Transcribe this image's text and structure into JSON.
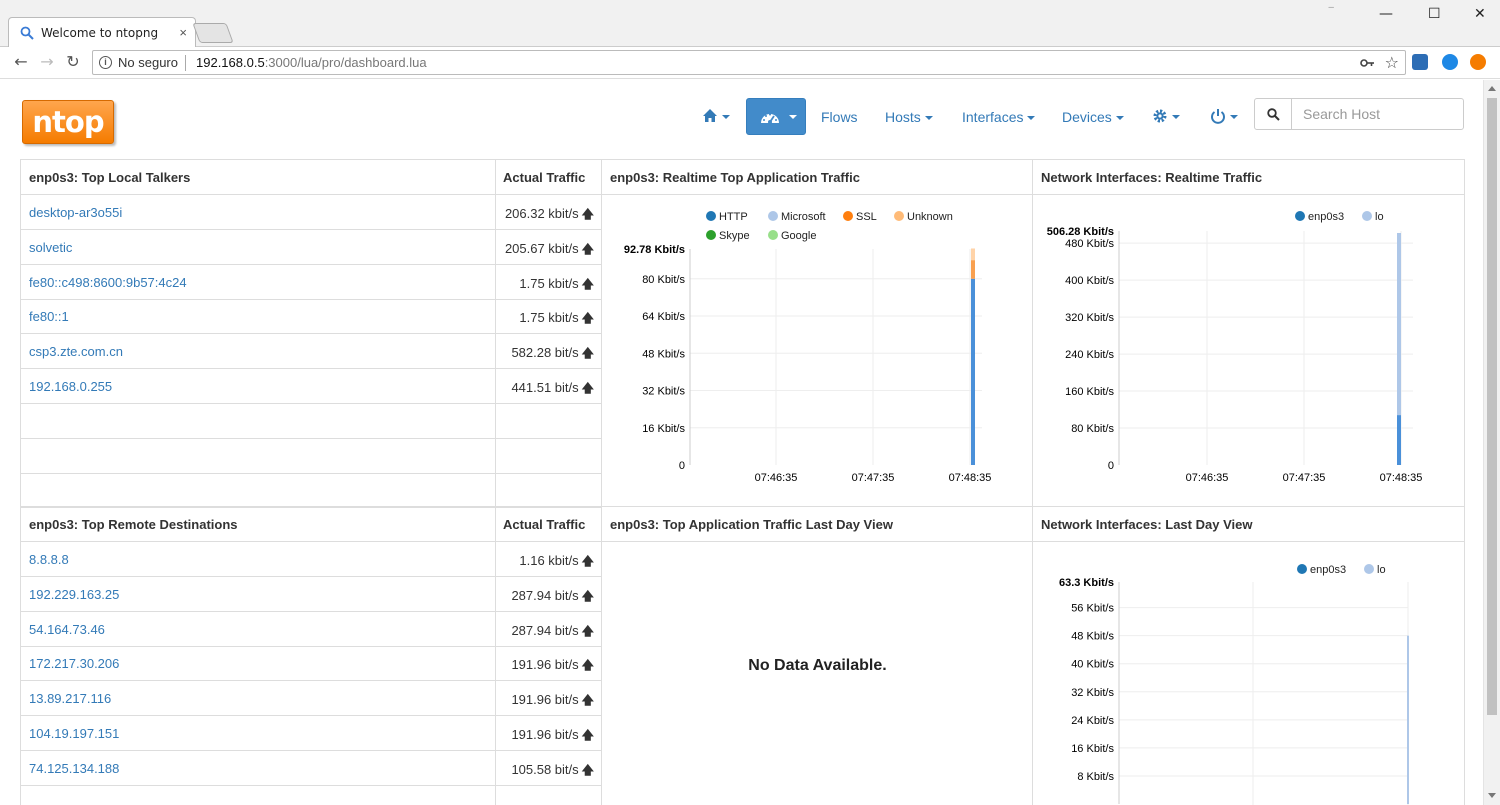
{
  "browser": {
    "tab_title": "Welcome to ntopng",
    "tab_close": "×",
    "window_minimize": "—",
    "window_maximize": "☐",
    "window_close": "✕",
    "secure_label": "No seguro",
    "url_host": "192.168.0.5",
    "url_rest": ":3000/lua/pro/dashboard.lua"
  },
  "app": {
    "logo": "ntop",
    "nav": {
      "flows": "Flows",
      "hosts": "Hosts",
      "interfaces": "Interfaces",
      "devices": "Devices"
    },
    "search_placeholder": "Search Host"
  },
  "top_local_talkers": {
    "title": "enp0s3: Top Local Talkers",
    "col_traffic": "Actual Traffic",
    "rows": [
      {
        "host": "desktop-ar3o55i",
        "traffic": "206.32 kbit/s"
      },
      {
        "host": "solvetic",
        "traffic": "205.67 kbit/s"
      },
      {
        "host": "fe80::c498:8600:9b57:4c24",
        "traffic": "1.75 kbit/s"
      },
      {
        "host": "fe80::1",
        "traffic": "1.75 kbit/s"
      },
      {
        "host": "csp3.zte.com.cn",
        "traffic": "582.28 bit/s"
      },
      {
        "host": "192.168.0.255",
        "traffic": "441.51 bit/s"
      }
    ]
  },
  "top_remote_destinations": {
    "title": "enp0s3: Top Remote Destinations",
    "col_traffic": "Actual Traffic",
    "rows": [
      {
        "host": "8.8.8.8",
        "traffic": "1.16 kbit/s"
      },
      {
        "host": "192.229.163.25",
        "traffic": "287.94 bit/s"
      },
      {
        "host": "54.164.73.46",
        "traffic": "287.94 bit/s"
      },
      {
        "host": "172.217.30.206",
        "traffic": "191.96 bit/s"
      },
      {
        "host": "13.89.217.116",
        "traffic": "191.96 bit/s"
      },
      {
        "host": "104.19.197.151",
        "traffic": "191.96 bit/s"
      },
      {
        "host": "74.125.134.188",
        "traffic": "105.58 bit/s"
      }
    ]
  },
  "app_traffic_last_day": {
    "title": "enp0s3: Top Application Traffic Last Day View",
    "message": "No Data Available."
  },
  "arrow_up": "🡅",
  "chart_data": [
    {
      "type": "area",
      "title": "enp0s3: Realtime Top Application Traffic",
      "max_label": "92.78 Kbit/s",
      "yticks": [
        "80 Kbit/s",
        "64 Kbit/s",
        "48 Kbit/s",
        "32 Kbit/s",
        "16 Kbit/s",
        "0"
      ],
      "ytick_values": [
        80,
        64,
        48,
        32,
        16,
        0
      ],
      "ylim": [
        0,
        92.78
      ],
      "xticks": [
        "07:46:35",
        "07:47:35",
        "07:48:35"
      ],
      "stacked": true,
      "series": [
        {
          "name": "HTTP",
          "color": "#1f77b4",
          "color_fill": "#4a90d9",
          "last_value": 80
        },
        {
          "name": "Microsoft",
          "color": "#aec7e8",
          "color_fill": "#aec7e8",
          "last_value": 0
        },
        {
          "name": "SSL",
          "color": "#ff7f0e",
          "color_fill": "#f9a04f",
          "last_value": 8
        },
        {
          "name": "Unknown",
          "color": "#ffbb78",
          "color_fill": "#ffd3a8",
          "last_value": 5
        },
        {
          "name": "Skype",
          "color": "#2ca02c",
          "color_fill": "#2ca02c",
          "last_value": 0
        },
        {
          "name": "Google",
          "color": "#98df8a",
          "color_fill": "#98df8a",
          "last_value": 0
        }
      ]
    },
    {
      "type": "area",
      "title": "Network Interfaces: Realtime Traffic",
      "max_label": "506.28 Kbit/s",
      "yticks": [
        "480 Kbit/s",
        "400 Kbit/s",
        "320 Kbit/s",
        "240 Kbit/s",
        "160 Kbit/s",
        "80 Kbit/s",
        "0"
      ],
      "ytick_values": [
        480,
        400,
        320,
        240,
        160,
        80,
        0
      ],
      "ylim": [
        0,
        506.28
      ],
      "xticks": [
        "07:46:35",
        "07:47:35",
        "07:48:35"
      ],
      "stacked": true,
      "series": [
        {
          "name": "enp0s3",
          "color": "#1f77b4",
          "color_fill": "#4a90d9",
          "last_value": 108
        },
        {
          "name": "lo",
          "color": "#aec7e8",
          "color_fill": "#aec7e8",
          "last_value": 394
        }
      ]
    },
    {
      "type": "area",
      "title": "Network Interfaces: Last Day View",
      "max_label": "63.3 Kbit/s",
      "yticks": [
        "56 Kbit/s",
        "48 Kbit/s",
        "40 Kbit/s",
        "32 Kbit/s",
        "24 Kbit/s",
        "16 Kbit/s",
        "8 Kbit/s"
      ],
      "ytick_values": [
        56,
        48,
        40,
        32,
        24,
        16,
        8
      ],
      "ylim": [
        0,
        63.3
      ],
      "stacked": true,
      "series": [
        {
          "name": "enp0s3",
          "color": "#1f77b4",
          "color_fill": "#4a90d9",
          "last_value": 0
        },
        {
          "name": "lo",
          "color": "#aec7e8",
          "color_fill": "#aec7e8",
          "last_value": 48
        }
      ]
    }
  ]
}
